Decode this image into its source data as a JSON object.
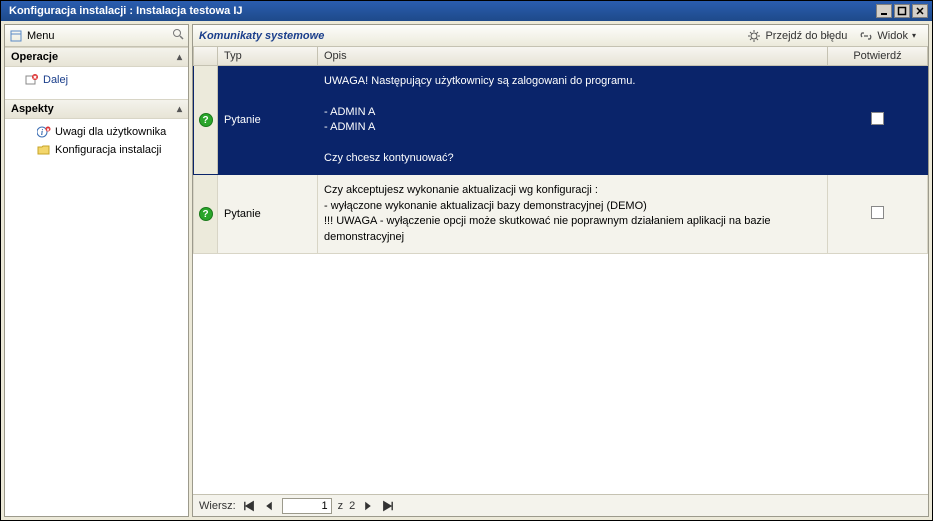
{
  "window": {
    "title": "Konfiguracja instalacji : Instalacja testowa IJ"
  },
  "menu": {
    "label": "Menu"
  },
  "sidebar": {
    "operacje": {
      "header": "Operacje",
      "items": [
        {
          "label": "Dalej"
        }
      ]
    },
    "aspekty": {
      "header": "Aspekty",
      "items": [
        {
          "label": "Uwagi dla użytkownika"
        },
        {
          "label": "Konfiguracja instalacji"
        }
      ]
    }
  },
  "toolbar": {
    "panel_title": "Komunikaty systemowe",
    "goto_error": "Przejdź do błędu",
    "view": "Widok"
  },
  "grid": {
    "columns": {
      "typ": "Typ",
      "opis": "Opis",
      "potwierdz": "Potwierdź"
    },
    "rows": [
      {
        "typ": "Pytanie",
        "opis": "UWAGA! Następujący użytkownicy są zalogowani do programu.\n\n   - ADMIN A\n   - ADMIN A\n\nCzy chcesz kontynuować?",
        "potwierdz": false,
        "selected": true
      },
      {
        "typ": "Pytanie",
        "opis": "Czy akceptujesz wykonanie aktualizacji wg konfiguracji :\n  - wyłączone wykonanie aktualizacji bazy demonstracyjnej (DEMO)\n    !!! UWAGA - wyłączenie opcji może skutkować nie poprawnym działaniem aplikacji na bazie demonstracyjnej",
        "potwierdz": false,
        "selected": false
      }
    ]
  },
  "pager": {
    "label": "Wiersz:",
    "current": "1",
    "sep": "z",
    "total": "2"
  }
}
